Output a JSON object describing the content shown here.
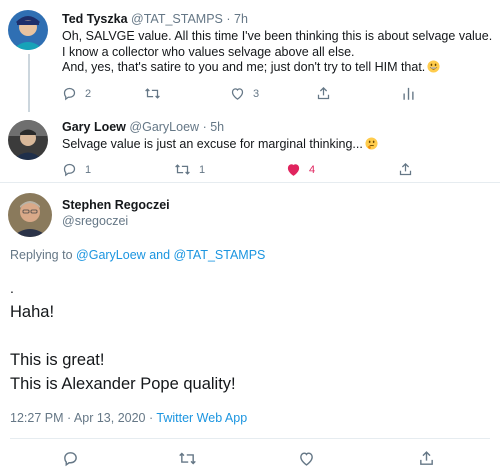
{
  "tweets": [
    {
      "name": "Ted Tyszka",
      "handle": "@TAT_STAMPS",
      "time": "· 7h",
      "lines": [
        "Oh, SALVGE value. All this time I've been thinking this is about selvage value.",
        "I know a collector who values selvage above all else.",
        "And, yes, that's satire to you and me; just don't try to tell HIM that."
      ],
      "emoji": "grinning-face-emoji",
      "actions": {
        "reply": "2",
        "retweet": "",
        "like": "3"
      }
    },
    {
      "name": "Gary Loew",
      "handle": "@GaryLoew",
      "time": "· 5h",
      "lines": [
        "Selvage value is just an excuse for marginal thinking..."
      ],
      "emoji": "thinking-face-emoji",
      "actions": {
        "reply": "1",
        "retweet": "1",
        "like": "4"
      }
    }
  ],
  "main_tweet": {
    "name": "Stephen Regoczei",
    "handle": "@sregoczei",
    "replying_prefix": "Replying to",
    "replying_user1": "@GaryLoew",
    "replying_and": "and",
    "replying_user2": "@TAT_STAMPS",
    "dot": ".",
    "line1": "Haha!",
    "line2": "This is great!",
    "line3": "This is Alexander Pope quality!",
    "timestamp": "12:27 PM · Apr 13, 2020 ·",
    "source": "Twitter Web App"
  },
  "colors": {
    "accent": "#1b95e0",
    "like_active": "#e0245e",
    "muted": "#657786",
    "text": "#14171a"
  }
}
